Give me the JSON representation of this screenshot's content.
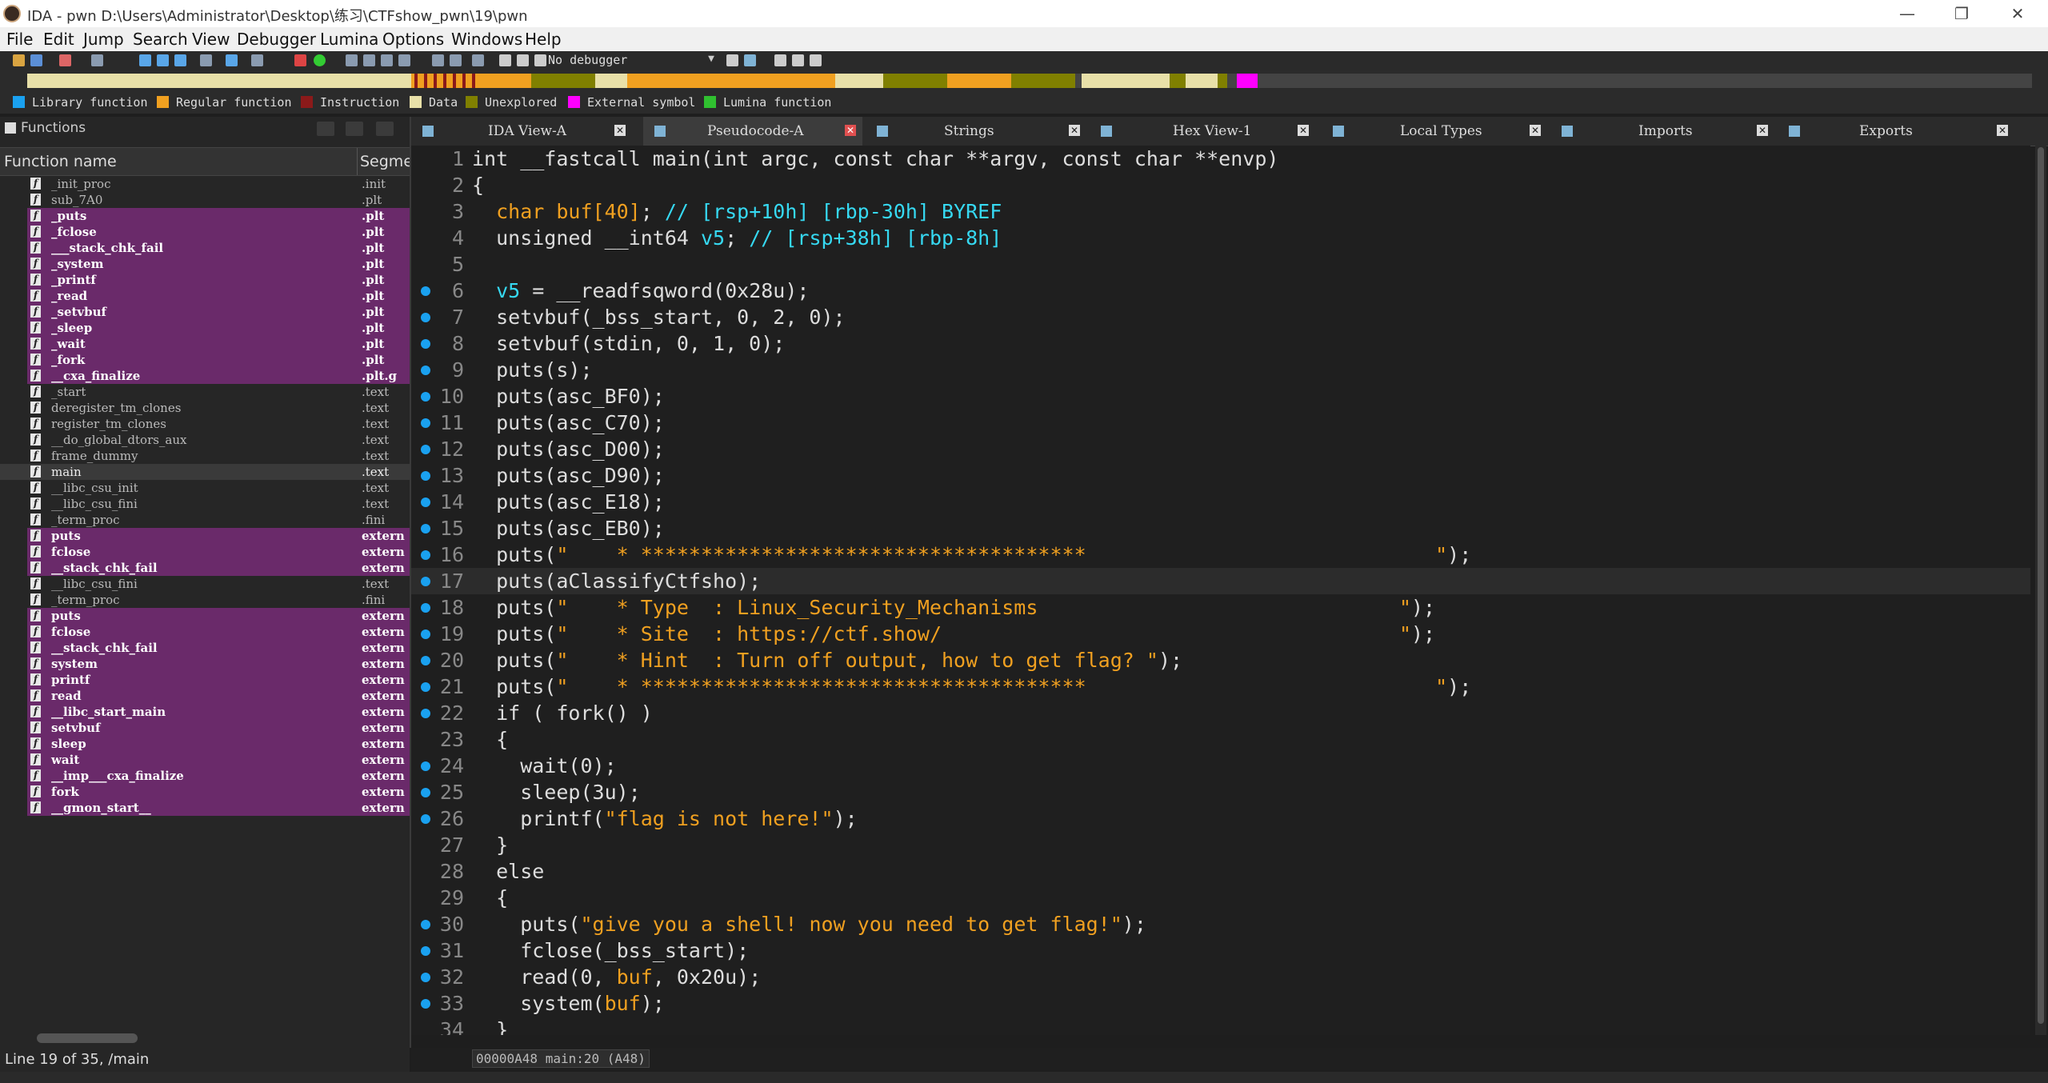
{
  "window": {
    "title": "IDA - pwn D:\\Users\\Administrator\\Desktop\\练习\\CTFshow_pwn\\19\\pwn",
    "controls": [
      "—",
      "❐",
      "✕"
    ]
  },
  "menu": [
    "File",
    "Edit",
    "Jump",
    "Search",
    "View",
    "Debugger",
    "Lumina",
    "Options",
    "Windows",
    "Help"
  ],
  "toolbar": {
    "debugger": "No debugger"
  },
  "legend": [
    {
      "label": "Library function",
      "color": "#1aa1f0"
    },
    {
      "label": "Regular function",
      "color": "#f0a020"
    },
    {
      "label": "Instruction",
      "color": "#8b1a1a"
    },
    {
      "label": "Data",
      "color": "#e8e0a8"
    },
    {
      "label": "Unexplored",
      "color": "#808000"
    },
    {
      "label": "External symbol",
      "color": "#ff00ff"
    },
    {
      "label": "Lumina function",
      "color": "#30c030"
    }
  ],
  "functions_panel": {
    "title": "Functions",
    "col_name": "Function name",
    "col_segment": "Segme",
    "rows": [
      {
        "name": "_init_proc",
        "seg": ".init",
        "kind": "reg"
      },
      {
        "name": "sub_7A0",
        "seg": ".plt",
        "kind": "reg"
      },
      {
        "name": "_puts",
        "seg": ".plt",
        "kind": "lib"
      },
      {
        "name": "_fclose",
        "seg": ".plt",
        "kind": "lib"
      },
      {
        "name": "___stack_chk_fail",
        "seg": ".plt",
        "kind": "lib"
      },
      {
        "name": "_system",
        "seg": ".plt",
        "kind": "lib"
      },
      {
        "name": "_printf",
        "seg": ".plt",
        "kind": "lib"
      },
      {
        "name": "_read",
        "seg": ".plt",
        "kind": "lib"
      },
      {
        "name": "_setvbuf",
        "seg": ".plt",
        "kind": "lib"
      },
      {
        "name": "_sleep",
        "seg": ".plt",
        "kind": "lib"
      },
      {
        "name": "_wait",
        "seg": ".plt",
        "kind": "lib"
      },
      {
        "name": "_fork",
        "seg": ".plt",
        "kind": "lib"
      },
      {
        "name": "__cxa_finalize",
        "seg": ".plt.g",
        "kind": "lib"
      },
      {
        "name": "_start",
        "seg": ".text",
        "kind": "reg"
      },
      {
        "name": "deregister_tm_clones",
        "seg": ".text",
        "kind": "reg"
      },
      {
        "name": "register_tm_clones",
        "seg": ".text",
        "kind": "reg"
      },
      {
        "name": "__do_global_dtors_aux",
        "seg": ".text",
        "kind": "reg"
      },
      {
        "name": "frame_dummy",
        "seg": ".text",
        "kind": "reg"
      },
      {
        "name": "main",
        "seg": ".text",
        "kind": "sel"
      },
      {
        "name": "__libc_csu_init",
        "seg": ".text",
        "kind": "reg"
      },
      {
        "name": "__libc_csu_fini",
        "seg": ".text",
        "kind": "reg"
      },
      {
        "name": "_term_proc",
        "seg": ".fini",
        "kind": "reg"
      },
      {
        "name": "puts",
        "seg": "extern",
        "kind": "lib"
      },
      {
        "name": "fclose",
        "seg": "extern",
        "kind": "lib"
      },
      {
        "name": "__stack_chk_fail",
        "seg": "extern",
        "kind": "lib"
      },
      {
        "name": "__libc_csu_fini",
        "seg": ".text",
        "kind": "reg"
      },
      {
        "name": "_term_proc",
        "seg": ".fini",
        "kind": "reg"
      },
      {
        "name": "puts",
        "seg": "extern",
        "kind": "lib"
      },
      {
        "name": "fclose",
        "seg": "extern",
        "kind": "lib"
      },
      {
        "name": "__stack_chk_fail",
        "seg": "extern",
        "kind": "lib"
      },
      {
        "name": "system",
        "seg": "extern",
        "kind": "lib"
      },
      {
        "name": "printf",
        "seg": "extern",
        "kind": "lib"
      },
      {
        "name": "read",
        "seg": "extern",
        "kind": "lib"
      },
      {
        "name": "__libc_start_main",
        "seg": "extern",
        "kind": "lib"
      },
      {
        "name": "setvbuf",
        "seg": "extern",
        "kind": "lib"
      },
      {
        "name": "sleep",
        "seg": "extern",
        "kind": "lib"
      },
      {
        "name": "wait",
        "seg": "extern",
        "kind": "lib"
      },
      {
        "name": "__imp___cxa_finalize",
        "seg": "extern",
        "kind": "lib"
      },
      {
        "name": "fork",
        "seg": "extern",
        "kind": "lib"
      },
      {
        "name": "__gmon_start__",
        "seg": "extern",
        "kind": "lib"
      }
    ],
    "status": "Line 19 of 35, /main"
  },
  "tabs": [
    {
      "label": "IDA View-A",
      "active": false
    },
    {
      "label": "Pseudocode-A",
      "active": true
    },
    {
      "label": "Strings",
      "active": false
    },
    {
      "label": "Hex View-1",
      "active": false
    },
    {
      "label": "Local Types",
      "active": false
    },
    {
      "label": "Imports",
      "active": false
    },
    {
      "label": "Exports",
      "active": false
    }
  ],
  "code": {
    "highlight_line": 17,
    "lines": [
      {
        "n": "1",
        "dot": false,
        "segs": [
          [
            "k",
            "int __fastcall main(int argc, const char **argv, const char **envp)"
          ]
        ]
      },
      {
        "n": "2",
        "dot": false,
        "segs": [
          [
            "k",
            "{"
          ]
        ]
      },
      {
        "n": "3",
        "dot": false,
        "segs": [
          [
            "k",
            "  "
          ],
          [
            "s",
            "char buf[40]"
          ],
          [
            "k",
            "; "
          ],
          [
            "c",
            "// [rsp+10h] [rbp-30h] BYREF"
          ]
        ]
      },
      {
        "n": "4",
        "dot": false,
        "segs": [
          [
            "k",
            "  unsigned __int64 "
          ],
          [
            "c",
            "v5"
          ],
          [
            "k",
            "; "
          ],
          [
            "c",
            "// [rsp+38h] [rbp-8h]"
          ]
        ]
      },
      {
        "n": "5",
        "dot": false,
        "segs": [
          [
            "k",
            ""
          ]
        ]
      },
      {
        "n": "6",
        "dot": true,
        "segs": [
          [
            "k",
            "  "
          ],
          [
            "c",
            "v5"
          ],
          [
            "k",
            " = __readfsqword(0x28u);"
          ]
        ]
      },
      {
        "n": "7",
        "dot": true,
        "segs": [
          [
            "k",
            "  setvbuf(_bss_start, 0, 2, 0);"
          ]
        ]
      },
      {
        "n": "8",
        "dot": true,
        "segs": [
          [
            "k",
            "  setvbuf(stdin, 0, 1, 0);"
          ]
        ]
      },
      {
        "n": "9",
        "dot": true,
        "segs": [
          [
            "k",
            "  puts(s);"
          ]
        ]
      },
      {
        "n": "10",
        "dot": true,
        "segs": [
          [
            "k",
            "  puts(asc_BF0);"
          ]
        ]
      },
      {
        "n": "11",
        "dot": true,
        "segs": [
          [
            "k",
            "  puts(asc_C70);"
          ]
        ]
      },
      {
        "n": "12",
        "dot": true,
        "segs": [
          [
            "k",
            "  puts(asc_D00);"
          ]
        ]
      },
      {
        "n": "13",
        "dot": true,
        "segs": [
          [
            "k",
            "  puts(asc_D90);"
          ]
        ]
      },
      {
        "n": "14",
        "dot": true,
        "segs": [
          [
            "k",
            "  puts(asc_E18);"
          ]
        ]
      },
      {
        "n": "15",
        "dot": true,
        "segs": [
          [
            "k",
            "  puts(asc_EB0);"
          ]
        ]
      },
      {
        "n": "16",
        "dot": true,
        "segs": [
          [
            "k",
            "  puts("
          ],
          [
            "s",
            "\"    * *************************************                             \""
          ],
          [
            "k",
            ");"
          ]
        ]
      },
      {
        "n": "17",
        "dot": true,
        "segs": [
          [
            "k",
            "  puts(aClassifyCtfsho);"
          ]
        ]
      },
      {
        "n": "18",
        "dot": true,
        "segs": [
          [
            "k",
            "  puts("
          ],
          [
            "s",
            "\"    * Type  : Linux_Security_Mechanisms                              \""
          ],
          [
            "k",
            ");"
          ]
        ]
      },
      {
        "n": "19",
        "dot": true,
        "segs": [
          [
            "k",
            "  puts("
          ],
          [
            "s",
            "\"    * Site  : https://ctf.show/                                      \""
          ],
          [
            "k",
            ");"
          ]
        ]
      },
      {
        "n": "20",
        "dot": true,
        "segs": [
          [
            "k",
            "  puts("
          ],
          [
            "s",
            "\"    * Hint  : Turn off output, how to get flag? \""
          ],
          [
            "k",
            ");"
          ]
        ]
      },
      {
        "n": "21",
        "dot": true,
        "segs": [
          [
            "k",
            "  puts("
          ],
          [
            "s",
            "\"    * *************************************                             \""
          ],
          [
            "k",
            ");"
          ]
        ]
      },
      {
        "n": "22",
        "dot": true,
        "segs": [
          [
            "k",
            "  if ( fork() )"
          ]
        ]
      },
      {
        "n": "23",
        "dot": false,
        "segs": [
          [
            "k",
            "  {"
          ]
        ]
      },
      {
        "n": "24",
        "dot": true,
        "segs": [
          [
            "k",
            "    wait(0);"
          ]
        ]
      },
      {
        "n": "25",
        "dot": true,
        "segs": [
          [
            "k",
            "    sleep(3u);"
          ]
        ]
      },
      {
        "n": "26",
        "dot": true,
        "segs": [
          [
            "k",
            "    printf("
          ],
          [
            "s",
            "\"flag is not here!\""
          ],
          [
            "k",
            ");"
          ]
        ]
      },
      {
        "n": "27",
        "dot": false,
        "segs": [
          [
            "k",
            "  }"
          ]
        ]
      },
      {
        "n": "28",
        "dot": false,
        "segs": [
          [
            "k",
            "  else"
          ]
        ]
      },
      {
        "n": "29",
        "dot": false,
        "segs": [
          [
            "k",
            "  {"
          ]
        ]
      },
      {
        "n": "30",
        "dot": true,
        "segs": [
          [
            "k",
            "    puts("
          ],
          [
            "s",
            "\"give you a shell! now you need to get flag!\""
          ],
          [
            "k",
            ");"
          ]
        ]
      },
      {
        "n": "31",
        "dot": true,
        "segs": [
          [
            "k",
            "    fclose(_bss_start);"
          ]
        ]
      },
      {
        "n": "32",
        "dot": true,
        "segs": [
          [
            "k",
            "    read(0, "
          ],
          [
            "s",
            "buf"
          ],
          [
            "k",
            ", 0x20u);"
          ]
        ]
      },
      {
        "n": "33",
        "dot": true,
        "segs": [
          [
            "k",
            "    system("
          ],
          [
            "s",
            "buf"
          ],
          [
            "k",
            ");"
          ]
        ]
      },
      {
        "n": "34",
        "dot": false,
        "segs": [
          [
            "k",
            "  }"
          ]
        ]
      }
    ],
    "status": "00000A48 main:20 (A48)"
  }
}
